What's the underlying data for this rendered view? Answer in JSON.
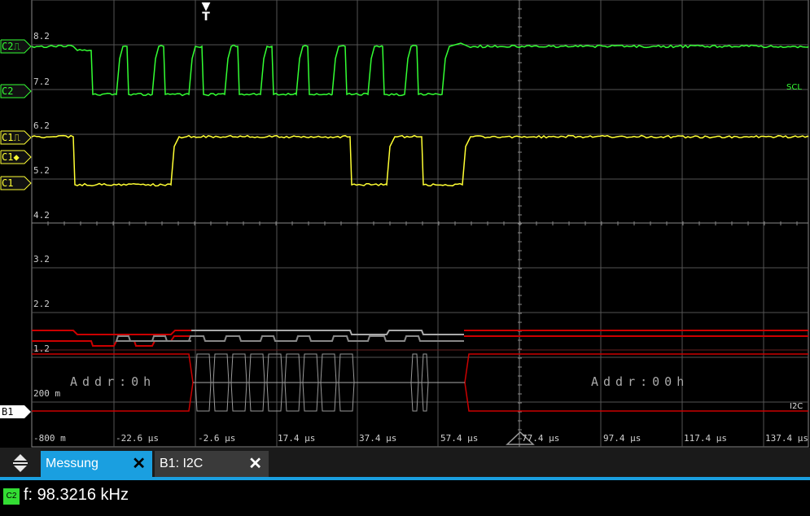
{
  "scope": {
    "y_labels": [
      "8.2",
      "7.2",
      "6.2",
      "5.2",
      "4.2",
      "3.2",
      "2.2",
      "1.2",
      "200 m"
    ],
    "x_labels": [
      "-800 m",
      "-22.6 µs",
      "-2.6 µs",
      "17.4 µs",
      "37.4 µs",
      "57.4 µs",
      "77.4 µs",
      "97.4 µs",
      "117.4 µs",
      "137.4 µs"
    ],
    "trigger_marker": "T",
    "channel_tags": {
      "c2_trig": "C2⎍",
      "c2": "C2",
      "c1_trig": "C1⎍",
      "c1_level": "C1◆",
      "c1": "C1",
      "b1": "B1"
    },
    "signal_labels": {
      "scl": "SCL",
      "i2c": "I2C"
    },
    "decode": {
      "left": "Addr:0h",
      "right": "Addr:00h"
    },
    "colors": {
      "c2": "#33ff33",
      "c1": "#ffff33",
      "bus": "#cc0000",
      "grid": "#555555"
    }
  },
  "tabs": [
    {
      "label": "Messung",
      "active": true,
      "close": "✕"
    },
    {
      "label": "B1: I2C",
      "active": false,
      "close": "✕"
    }
  ],
  "measurement": {
    "channel_badge": "C2",
    "text": "f: 98.3216 kHz"
  }
}
